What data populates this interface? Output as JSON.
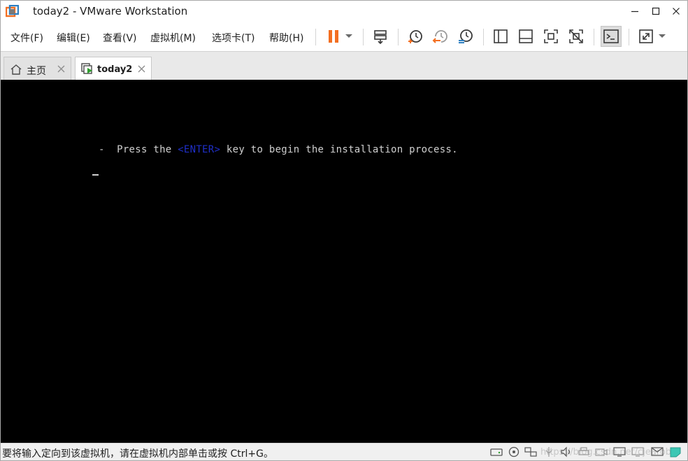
{
  "window": {
    "title": "today2 - VMware Workstation",
    "app_icon": "vmware-logo-icon",
    "controls": [
      "minimize-icon",
      "maximize-icon",
      "close-icon"
    ]
  },
  "menu": [
    {
      "label": "文件(F)"
    },
    {
      "label": "编辑(E)"
    },
    {
      "label": "查看(V)"
    },
    {
      "label": "虚拟机(M)"
    },
    {
      "label": "选项卡(T)"
    },
    {
      "label": "帮助(H)"
    }
  ],
  "toolbar": {
    "icons": [
      "pause-icon",
      "dropdown-arrow-icon",
      "send-ctrl-alt-del-icon",
      "snapshot-take-icon",
      "snapshot-revert-icon",
      "snapshot-manager-icon",
      "show-library-icon",
      "show-thumbnail-bar-icon",
      "fullscreen-icon",
      "unity-icon",
      "console-view-icon",
      "stretch-icon",
      "dropdown-arrow-icon"
    ],
    "accent_color": "#f36f21"
  },
  "tabs": [
    {
      "label": "主页",
      "icon": "home-icon",
      "active": false
    },
    {
      "label": "today2",
      "icon": "vm-running-icon",
      "active": true
    }
  ],
  "console": {
    "line_prefix": "-  Press the ",
    "line_key": "<ENTER>",
    "line_suffix": " key to begin the installation process.",
    "key_color": "#1f2fc8",
    "background": "#000000",
    "text_color": "#cfcfcf"
  },
  "status": {
    "message": "要将输入定向到该虚拟机，请在虚拟机内部单击或按 Ctrl+G。",
    "icons": [
      "hard-disk-icon",
      "cd-dvd-icon",
      "network-icon",
      "usb-icon",
      "display-icon",
      "sound-icon",
      "printer-icon",
      "camera-icon",
      "monitor-icon",
      "message-icon",
      "notes-icon"
    ],
    "watermark": "https://blog.csdn.net/cjearob"
  }
}
